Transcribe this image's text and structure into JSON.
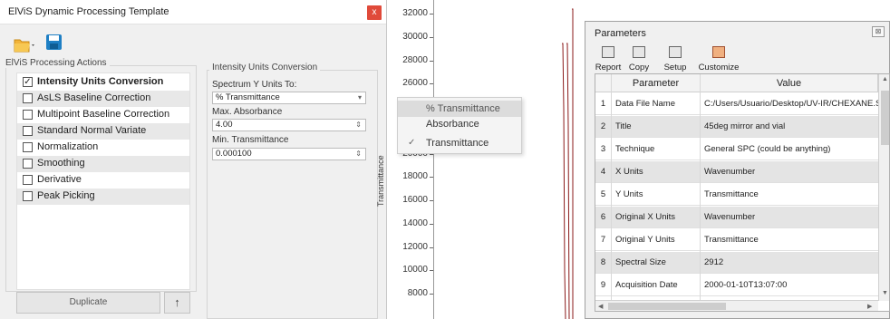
{
  "dialog": {
    "title": "ElViS Dynamic Processing Template",
    "close": "x",
    "actions_group_label": "ElViS Processing Actions",
    "actions": [
      {
        "label": "Intensity Units Conversion",
        "checked": true,
        "bold": true
      },
      {
        "label": "AsLS Baseline Correction",
        "checked": false
      },
      {
        "label": "Multipoint Baseline Correction",
        "checked": false
      },
      {
        "label": "Standard Normal Variate",
        "checked": false
      },
      {
        "label": "Normalization",
        "checked": false
      },
      {
        "label": "Smoothing",
        "checked": false
      },
      {
        "label": "Derivative",
        "checked": false
      },
      {
        "label": "Peak Picking",
        "checked": false
      }
    ],
    "duplicate_label": "Duplicate",
    "up_arrow": "↑",
    "iuc": {
      "group_label": "Intensity Units Conversion",
      "spectrum_label": "Spectrum Y Units To:",
      "spectrum_value": "% Transmittance",
      "max_abs_label": "Max. Absorbance",
      "max_abs_value": "4.00",
      "min_trans_label": "Min. Transmittance",
      "min_trans_value": "0.000100"
    }
  },
  "dropdown": {
    "options": [
      "% Transmittance",
      "Absorbance",
      "Transmittance"
    ],
    "highlighted": 0,
    "checked": 2
  },
  "chart_data": {
    "type": "line",
    "ylabel": "Transmittance",
    "yticks": [
      "32000",
      "30000",
      "28000",
      "26000",
      "24000",
      "22000",
      "20000",
      "18000",
      "16000",
      "14000",
      "12000",
      "10000",
      "8000"
    ],
    "line_color": "#8b1a1a"
  },
  "parameters": {
    "title": "Parameters",
    "close": "⊠",
    "toolbar": [
      "Report",
      "Copy",
      "Setup",
      "Customize"
    ],
    "headers": [
      "Parameter",
      "Value"
    ],
    "rows": [
      {
        "n": "1",
        "param": "Data File Name",
        "value": "C:/Users/Usuario/Desktop/UV-IR/CHEXANE.SPC"
      },
      {
        "n": "2",
        "param": "Title",
        "value": "45deg mirror and vial"
      },
      {
        "n": "3",
        "param": "Technique",
        "value": "General SPC (could be anything)"
      },
      {
        "n": "4",
        "param": "X Units",
        "value": "Wavenumber"
      },
      {
        "n": "5",
        "param": "Y Units",
        "value": "Transmittance"
      },
      {
        "n": "6",
        "param": "Original X Units",
        "value": "Wavenumber"
      },
      {
        "n": "7",
        "param": "Original Y Units",
        "value": "Transmittance"
      },
      {
        "n": "8",
        "param": "Spectral Size",
        "value": "2912"
      },
      {
        "n": "9",
        "param": "Acquisition Date",
        "value": "2000-01-10T13:07:00"
      }
    ]
  }
}
